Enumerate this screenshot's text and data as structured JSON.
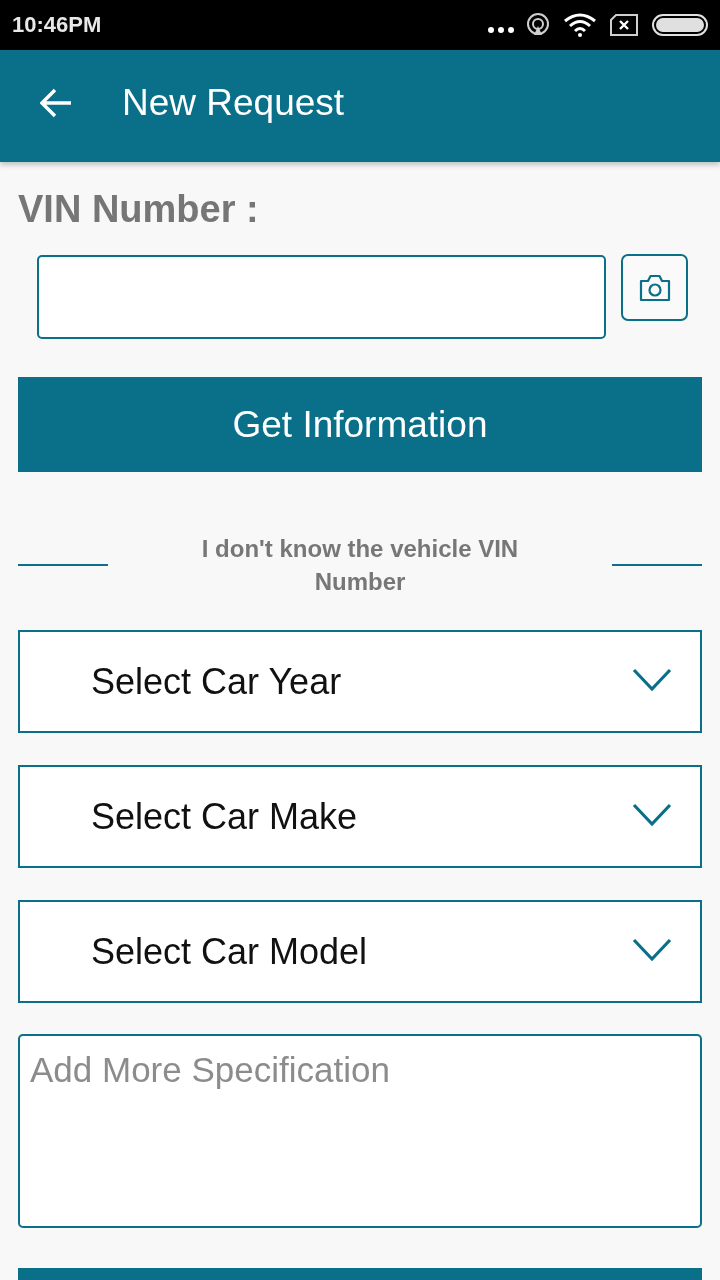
{
  "status_bar": {
    "time": "10:46PM"
  },
  "app_bar": {
    "title": "New Request"
  },
  "vin": {
    "label": "VIN Number :"
  },
  "get_info_button": {
    "label": "Get Information"
  },
  "divider_text": "I don't know the vehicle VIN Number",
  "dropdowns": [
    {
      "label": "Select Car Year"
    },
    {
      "label": "Select Car Make"
    },
    {
      "label": "Select Car Model"
    }
  ],
  "specification": {
    "placeholder": "Add More Specification"
  }
}
